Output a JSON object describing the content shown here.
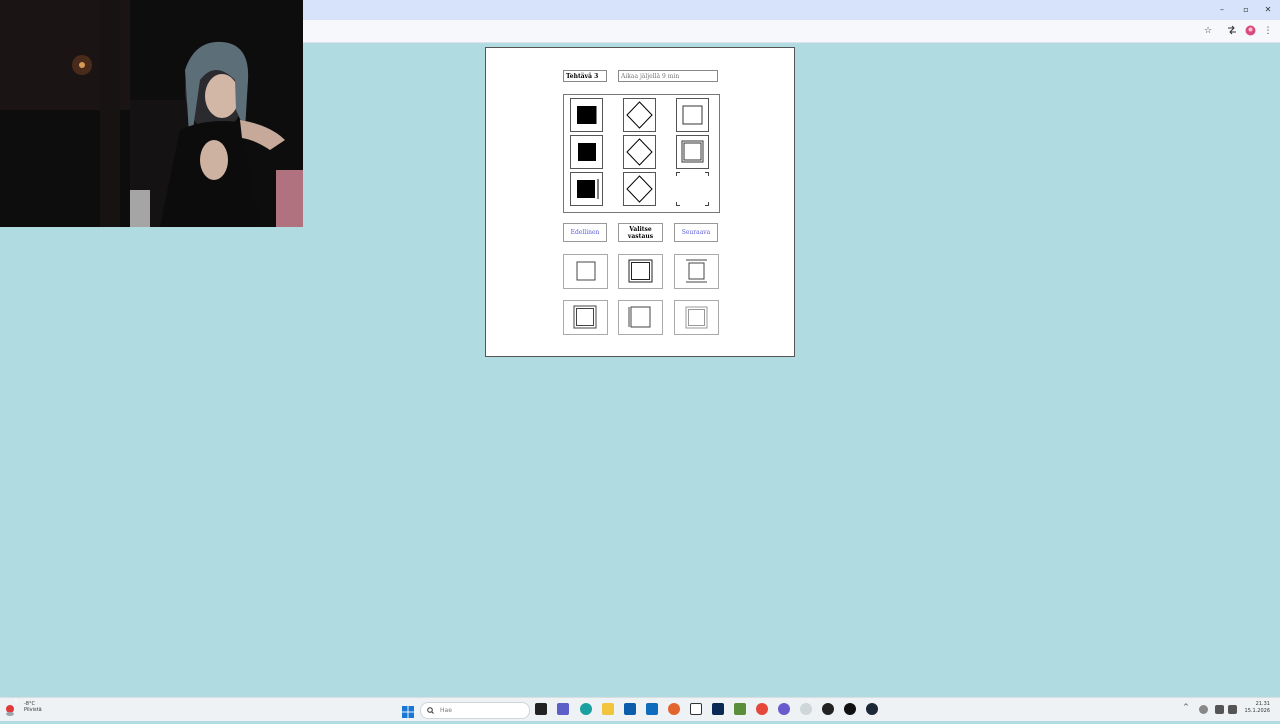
{
  "browser": {
    "window_controls": {
      "minimize": "–",
      "maximize": "▫",
      "close": "✕"
    },
    "toolbar_icons": {
      "star": "☆",
      "menu": "⋮"
    }
  },
  "app": {
    "task_label": "Tehtävä 3",
    "assignment_label": "Aikaa jäljellä 9 min",
    "buttons": {
      "previous": "Edellinen",
      "choose": "Valitse vastaus",
      "next": "Seuraava"
    }
  },
  "taskbar": {
    "search_placeholder": "Hae",
    "weather": {
      "temp": "-8°C",
      "condition": "Pilvistä",
      "badge": "3"
    },
    "clock": {
      "time": "21.31",
      "date": "15.1.2026"
    }
  },
  "colors": {
    "desktop": "#b0dce1",
    "browser_tab_bar": "#d6e3fb"
  }
}
